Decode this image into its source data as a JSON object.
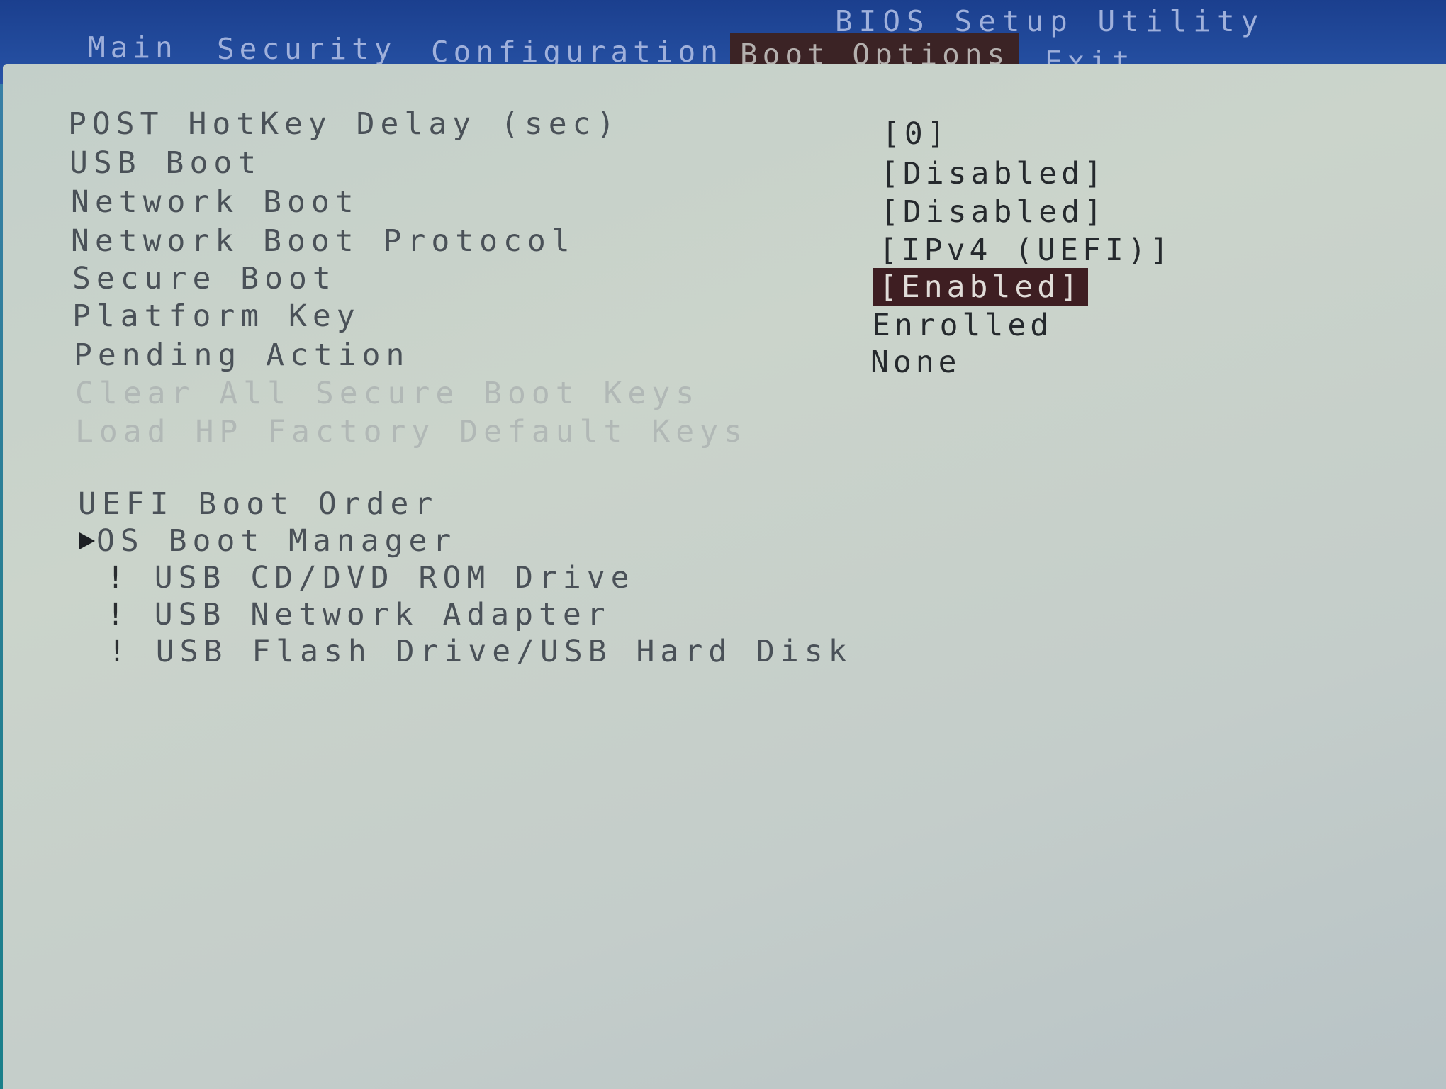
{
  "header": {
    "title": "BIOS Setup Utility",
    "tabs": [
      {
        "label": "Main"
      },
      {
        "label": "Security"
      },
      {
        "label": "Configuration"
      },
      {
        "label": "Boot Options",
        "active": true
      },
      {
        "label": "Exit"
      }
    ]
  },
  "settings": [
    {
      "label": "POST HotKey Delay (sec)",
      "value": "[0]"
    },
    {
      "label": "USB Boot",
      "value": "[Disabled]"
    },
    {
      "label": "Network Boot",
      "value": "[Disabled]"
    },
    {
      "label": "Network Boot Protocol",
      "value": "[IPv4 (UEFI)]"
    },
    {
      "label": "Secure Boot",
      "value": "[Enabled]",
      "selected": true
    },
    {
      "label": "Platform Key",
      "value": "Enrolled"
    },
    {
      "label": "Pending Action",
      "value": "None"
    },
    {
      "label": "Clear All Secure Boot Keys"
    },
    {
      "label": "Load HP Factory Default Keys"
    }
  ],
  "boot_order": {
    "title": "UEFI Boot Order",
    "manager": "OS Boot Manager",
    "bullet": "!",
    "devices": [
      "USB CD/DVD ROM Drive",
      "USB Network Adapter",
      "USB Flash Drive/USB Hard Disk"
    ]
  },
  "colors": {
    "header_bg": "#2753a6",
    "active_tab_bg": "#3b2325",
    "panel_bg": "#c6d0ca",
    "selected_value_bg": "#3e1e22"
  },
  "icons": {
    "manager_arrow": "arrow-right-icon"
  }
}
